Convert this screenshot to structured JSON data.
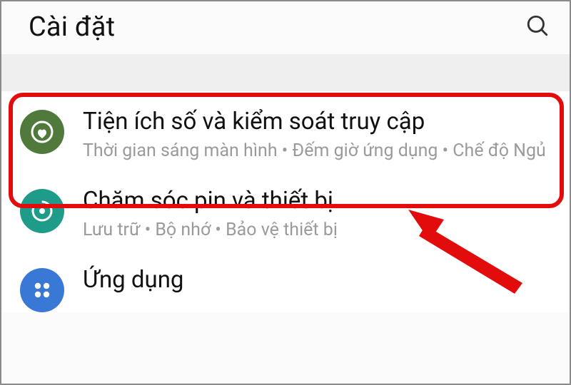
{
  "header": {
    "title": "Cài đặt"
  },
  "icons": {
    "search": "search-icon",
    "wellbeing": "wellbeing-icon",
    "care": "device-care-icon",
    "apps": "apps-icon"
  },
  "items": [
    {
      "title": "Tiện ích số và kiểm soát truy cập",
      "subtitle": "Thời gian sáng màn hình  •  Đếm giờ ứng dụng  •  Chế độ Ngủ"
    },
    {
      "title": "Chăm sóc pin và thiết bị",
      "subtitle": "Lưu trữ  •  Bộ nhớ  •  Bảo vệ thiết bị"
    },
    {
      "title": "Ứng dụng",
      "subtitle": ""
    }
  ],
  "annotation": {
    "highlight_target": "item-digital-wellbeing",
    "arrow_target": "item-digital-wellbeing",
    "highlight_color": "#e20c0c"
  }
}
